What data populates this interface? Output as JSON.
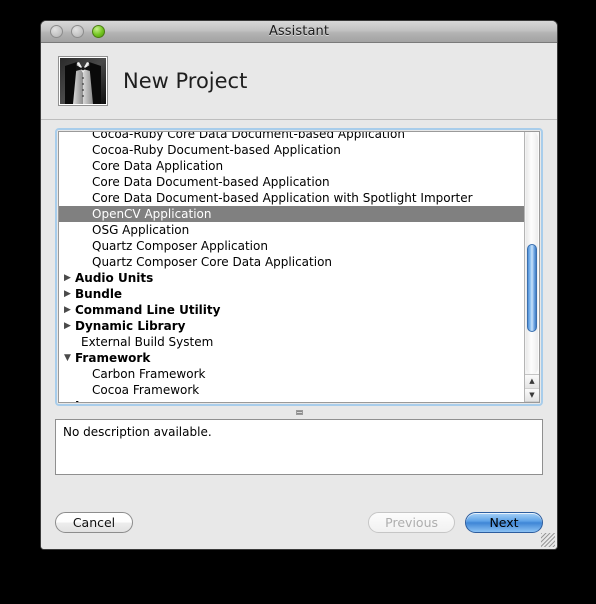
{
  "window": {
    "title": "Assistant",
    "controls": [
      "close-button",
      "minimize-button",
      "zoom-button"
    ]
  },
  "header": {
    "icon": "tuxedo-assistant-icon",
    "title": "New Project"
  },
  "list": {
    "rows": [
      {
        "label": "Cocoa-Ruby Core Data Document-based Application",
        "type": "child",
        "selected": false,
        "clipped": true
      },
      {
        "label": "Cocoa-Ruby Document-based Application",
        "type": "child",
        "selected": false
      },
      {
        "label": "Core Data Application",
        "type": "child",
        "selected": false
      },
      {
        "label": "Core Data Document-based Application",
        "type": "child",
        "selected": false
      },
      {
        "label": "Core Data Document-based Application with Spotlight Importer",
        "type": "child",
        "selected": false
      },
      {
        "label": "OpenCV Application",
        "type": "child",
        "selected": true
      },
      {
        "label": "OSG Application",
        "type": "child",
        "selected": false
      },
      {
        "label": "Quartz Composer Application",
        "type": "child",
        "selected": false
      },
      {
        "label": "Quartz Composer Core Data Application",
        "type": "child",
        "selected": false
      },
      {
        "label": "Audio Units",
        "type": "group",
        "expanded": false,
        "selected": false
      },
      {
        "label": "Bundle",
        "type": "group",
        "expanded": false,
        "selected": false
      },
      {
        "label": "Command Line Utility",
        "type": "group",
        "expanded": false,
        "selected": false
      },
      {
        "label": "Dynamic Library",
        "type": "group",
        "expanded": false,
        "selected": false
      },
      {
        "label": "External Build System",
        "type": "leaf",
        "selected": false
      },
      {
        "label": "Framework",
        "type": "group",
        "expanded": true,
        "selected": false
      },
      {
        "label": "Carbon Framework",
        "type": "child",
        "selected": false
      },
      {
        "label": "Cocoa Framework",
        "type": "child",
        "selected": false
      },
      {
        "label": "Java",
        "type": "group",
        "expanded": false,
        "selected": false
      }
    ],
    "triangle_collapsed": "▶",
    "triangle_expanded": "▼",
    "selection_color": "#808080",
    "scrollbar": {
      "up_arrow": "▲",
      "down_arrow": "▼",
      "thumb_color": "#4f8fd8"
    }
  },
  "description": {
    "text": "No description available."
  },
  "buttons": {
    "cancel": "Cancel",
    "previous": "Previous",
    "next": "Next",
    "next_accent": "#3f86d6"
  }
}
